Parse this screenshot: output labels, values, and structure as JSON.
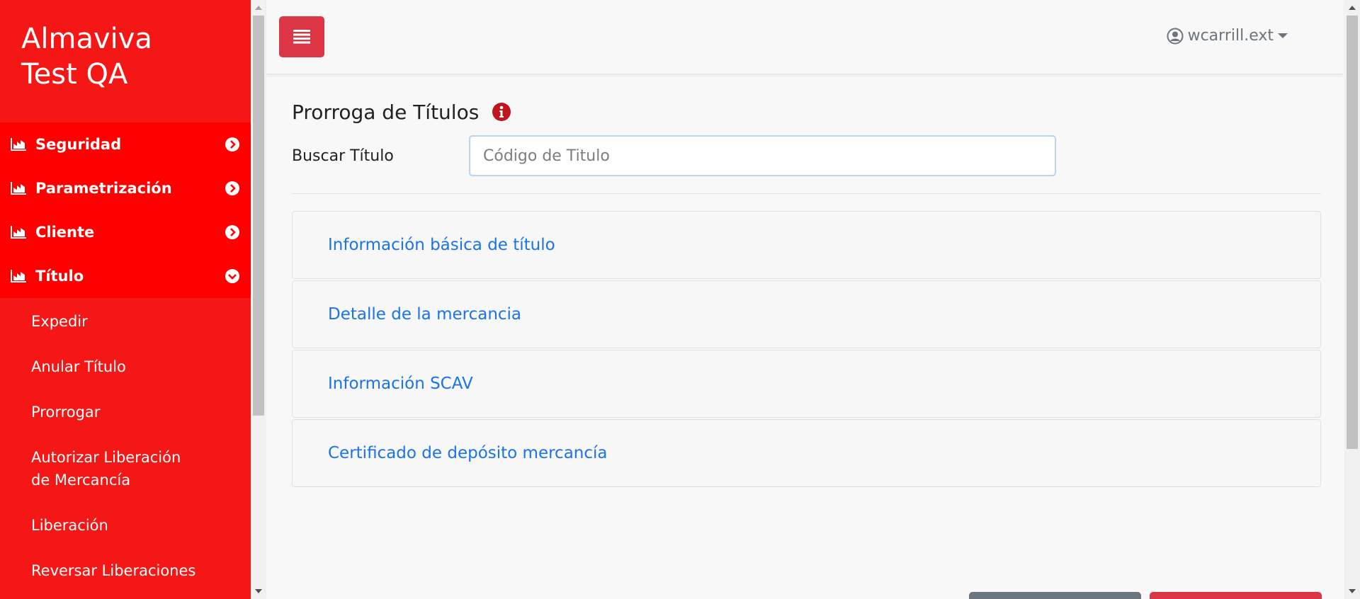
{
  "brand": {
    "line1": "Almaviva",
    "line2": "Test QA"
  },
  "sidebar": {
    "menu": [
      {
        "label": "Seguridad",
        "icon": "chart-icon",
        "expanded": false
      },
      {
        "label": "Parametrización",
        "icon": "chart-icon",
        "expanded": false
      },
      {
        "label": "Cliente",
        "icon": "chart-icon",
        "expanded": false
      },
      {
        "label": "Título",
        "icon": "chart-icon",
        "expanded": true
      }
    ],
    "submenu": [
      {
        "label": "Expedir"
      },
      {
        "label": "Anular Título"
      },
      {
        "label": "Prorrogar"
      },
      {
        "label": "Autorizar Liberación de Mercancía"
      },
      {
        "label": "Liberación"
      },
      {
        "label": "Reversar Liberaciones"
      }
    ]
  },
  "topbar": {
    "toggle_icon": "list-icon",
    "user": {
      "name": "wcarrill.ext",
      "icon": "user-circle-icon"
    }
  },
  "main": {
    "title": "Prorroga de Títulos",
    "info_icon": "info-circle-icon",
    "search": {
      "label": "Buscar Título",
      "placeholder": "Código de Titulo",
      "value": ""
    },
    "accordion": [
      {
        "label": "Información básica de título"
      },
      {
        "label": "Detalle de la mercancia"
      },
      {
        "label": "Información SCAV"
      },
      {
        "label": "Certificado de depósito mercancía"
      }
    ]
  },
  "colors": {
    "sidebar": "#f51616",
    "menu_bg": "#ff0000",
    "accent_red": "#dc3545",
    "link": "#1a73e8",
    "muted": "#6c757d"
  }
}
